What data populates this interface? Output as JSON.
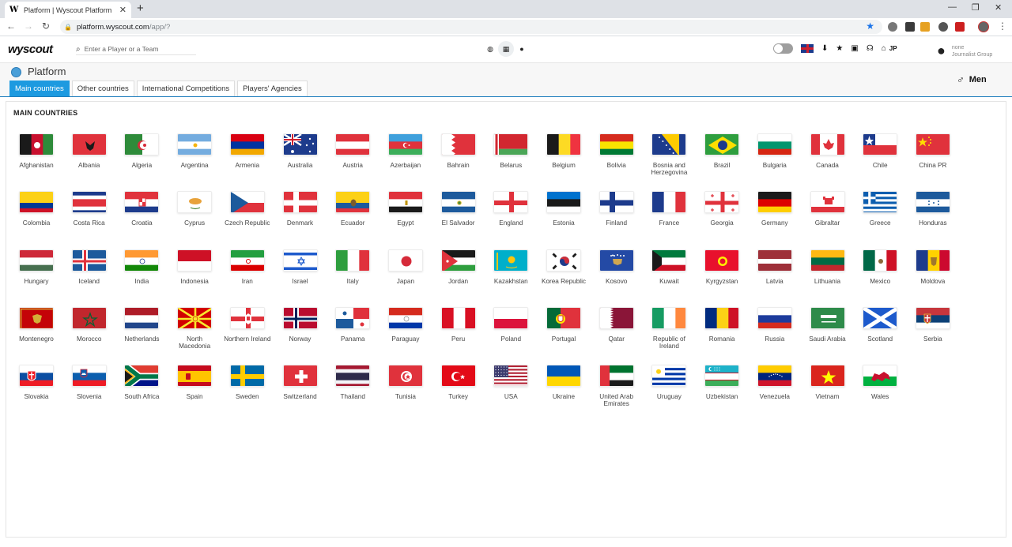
{
  "browser": {
    "tab_title": "Platform | Wyscout Platform",
    "favicon_letter": "W",
    "new_tab": "+",
    "url_host": "platform.wyscout.com",
    "url_path": "/app/?"
  },
  "header": {
    "logo": "wyscout",
    "search_placeholder": "Enter a Player or a Team",
    "home_label": "JP",
    "user_name": "none",
    "user_group": "Journalist Group"
  },
  "platform": {
    "title": "Platform",
    "tabs": [
      {
        "label": "Main countries",
        "active": true
      },
      {
        "label": "Other countries",
        "active": false
      },
      {
        "label": "International Competitions",
        "active": false
      },
      {
        "label": "Players' Agencies",
        "active": false
      }
    ],
    "gender": "Men"
  },
  "main": {
    "section_title": "MAIN COUNTRIES",
    "countries": [
      {
        "name": "Afghanistan",
        "flag": "afghanistan"
      },
      {
        "name": "Albania",
        "flag": "albania"
      },
      {
        "name": "Algeria",
        "flag": "algeria"
      },
      {
        "name": "Argentina",
        "flag": "argentina"
      },
      {
        "name": "Armenia",
        "flag": "armenia"
      },
      {
        "name": "Australia",
        "flag": "australia"
      },
      {
        "name": "Austria",
        "flag": "austria"
      },
      {
        "name": "Azerbaijan",
        "flag": "azerbaijan"
      },
      {
        "name": "Bahrain",
        "flag": "bahrain"
      },
      {
        "name": "Belarus",
        "flag": "belarus"
      },
      {
        "name": "Belgium",
        "flag": "belgium"
      },
      {
        "name": "Bolivia",
        "flag": "bolivia"
      },
      {
        "name": "Bosnia and Herzegovina",
        "flag": "bosnia"
      },
      {
        "name": "Brazil",
        "flag": "brazil"
      },
      {
        "name": "Bulgaria",
        "flag": "bulgaria"
      },
      {
        "name": "Canada",
        "flag": "canada"
      },
      {
        "name": "Chile",
        "flag": "chile"
      },
      {
        "name": "China PR",
        "flag": "china"
      },
      {
        "name": "Colombia",
        "flag": "colombia"
      },
      {
        "name": "Costa Rica",
        "flag": "costa-rica"
      },
      {
        "name": "Croatia",
        "flag": "croatia"
      },
      {
        "name": "Cyprus",
        "flag": "cyprus"
      },
      {
        "name": "Czech Republic",
        "flag": "czech"
      },
      {
        "name": "Denmark",
        "flag": "denmark"
      },
      {
        "name": "Ecuador",
        "flag": "ecuador"
      },
      {
        "name": "Egypt",
        "flag": "egypt"
      },
      {
        "name": "El Salvador",
        "flag": "el-salvador"
      },
      {
        "name": "England",
        "flag": "england"
      },
      {
        "name": "Estonia",
        "flag": "estonia"
      },
      {
        "name": "Finland",
        "flag": "finland"
      },
      {
        "name": "France",
        "flag": "france"
      },
      {
        "name": "Georgia",
        "flag": "georgia"
      },
      {
        "name": "Germany",
        "flag": "germany"
      },
      {
        "name": "Gibraltar",
        "flag": "gibraltar"
      },
      {
        "name": "Greece",
        "flag": "greece"
      },
      {
        "name": "Honduras",
        "flag": "honduras"
      },
      {
        "name": "Hungary",
        "flag": "hungary"
      },
      {
        "name": "Iceland",
        "flag": "iceland"
      },
      {
        "name": "India",
        "flag": "india"
      },
      {
        "name": "Indonesia",
        "flag": "indonesia"
      },
      {
        "name": "Iran",
        "flag": "iran"
      },
      {
        "name": "Israel",
        "flag": "israel"
      },
      {
        "name": "Italy",
        "flag": "italy"
      },
      {
        "name": "Japan",
        "flag": "japan"
      },
      {
        "name": "Jordan",
        "flag": "jordan"
      },
      {
        "name": "Kazakhstan",
        "flag": "kazakhstan"
      },
      {
        "name": "Korea Republic",
        "flag": "korea"
      },
      {
        "name": "Kosovo",
        "flag": "kosovo"
      },
      {
        "name": "Kuwait",
        "flag": "kuwait"
      },
      {
        "name": "Kyrgyzstan",
        "flag": "kyrgyzstan"
      },
      {
        "name": "Latvia",
        "flag": "latvia"
      },
      {
        "name": "Lithuania",
        "flag": "lithuania"
      },
      {
        "name": "Mexico",
        "flag": "mexico"
      },
      {
        "name": "Moldova",
        "flag": "moldova"
      },
      {
        "name": "Montenegro",
        "flag": "montenegro"
      },
      {
        "name": "Morocco",
        "flag": "morocco"
      },
      {
        "name": "Netherlands",
        "flag": "netherlands"
      },
      {
        "name": "North Macedonia",
        "flag": "macedonia"
      },
      {
        "name": "Northern Ireland",
        "flag": "northern-ireland"
      },
      {
        "name": "Norway",
        "flag": "norway"
      },
      {
        "name": "Panama",
        "flag": "panama"
      },
      {
        "name": "Paraguay",
        "flag": "paraguay"
      },
      {
        "name": "Peru",
        "flag": "peru"
      },
      {
        "name": "Poland",
        "flag": "poland"
      },
      {
        "name": "Portugal",
        "flag": "portugal"
      },
      {
        "name": "Qatar",
        "flag": "qatar"
      },
      {
        "name": "Republic of Ireland",
        "flag": "ireland"
      },
      {
        "name": "Romania",
        "flag": "romania"
      },
      {
        "name": "Russia",
        "flag": "russia"
      },
      {
        "name": "Saudi Arabia",
        "flag": "saudi-arabia"
      },
      {
        "name": "Scotland",
        "flag": "scotland"
      },
      {
        "name": "Serbia",
        "flag": "serbia"
      },
      {
        "name": "Slovakia",
        "flag": "slovakia"
      },
      {
        "name": "Slovenia",
        "flag": "slovenia"
      },
      {
        "name": "South Africa",
        "flag": "south-africa"
      },
      {
        "name": "Spain",
        "flag": "spain"
      },
      {
        "name": "Sweden",
        "flag": "sweden"
      },
      {
        "name": "Switzerland",
        "flag": "switzerland"
      },
      {
        "name": "Thailand",
        "flag": "thailand"
      },
      {
        "name": "Tunisia",
        "flag": "tunisia"
      },
      {
        "name": "Turkey",
        "flag": "turkey"
      },
      {
        "name": "USA",
        "flag": "usa"
      },
      {
        "name": "Ukraine",
        "flag": "ukraine"
      },
      {
        "name": "United Arab Emirates",
        "flag": "uae"
      },
      {
        "name": "Uruguay",
        "flag": "uruguay"
      },
      {
        "name": "Uzbekistan",
        "flag": "uzbekistan"
      },
      {
        "name": "Venezuela",
        "flag": "venezuela"
      },
      {
        "name": "Vietnam",
        "flag": "vietnam"
      },
      {
        "name": "Wales",
        "flag": "wales"
      }
    ]
  },
  "colors": {
    "accent": "#1d9ae0",
    "brand": "#111111",
    "bookmark_star": "#1a73e8"
  }
}
